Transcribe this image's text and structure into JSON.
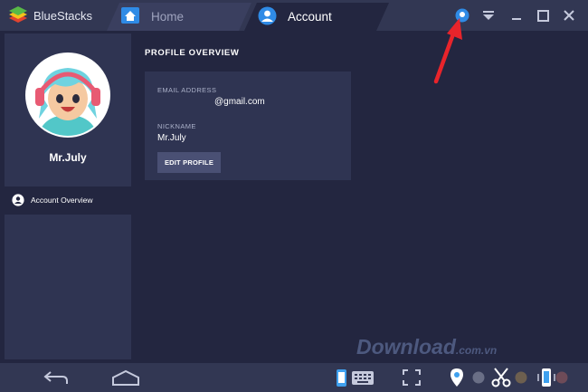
{
  "app": {
    "name": "BlueStacks"
  },
  "tabs": [
    {
      "label": "Home",
      "active": false
    },
    {
      "label": "Account",
      "active": true
    }
  ],
  "sidebar": {
    "username": "Mr.July",
    "menu": [
      {
        "label": "Account Overview",
        "icon": "user-circle-icon"
      }
    ]
  },
  "main": {
    "title": "PROFILE OVERVIEW",
    "email_label": "EMAIL ADDRESS",
    "email_value": "@gmail.com",
    "nickname_label": "NICKNAME",
    "nickname_value": "Mr.July",
    "edit_button": "EDIT PROFILE"
  },
  "watermark": {
    "main": "Download",
    "suffix": ".com.vn"
  },
  "colors": {
    "background": "#232640",
    "panel": "#2f3452",
    "titlebar": "#323753",
    "accent": "#2f8be6",
    "annotation": "#e8242b"
  }
}
